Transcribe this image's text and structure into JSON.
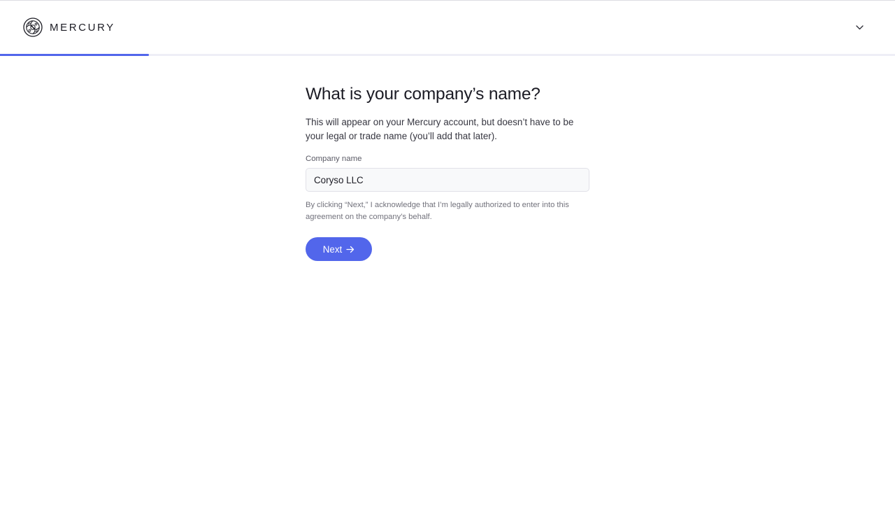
{
  "header": {
    "brand_name": "MERCURY",
    "logo_icon": "mercury-logo-icon",
    "menu_icon": "chevron-down-icon"
  },
  "progress": {
    "fraction": 0.1664,
    "color": "#5266eb",
    "track_color": "#eeeef6"
  },
  "form": {
    "title": "What is your company’s name?",
    "subtitle": "This will appear on your Mercury account, but doesn’t have to be your legal or trade name (you’ll add that later).",
    "company_name_label": "Company name",
    "company_name_value": "Coryso LLC",
    "disclaimer": "By clicking “Next,” I acknowledge that I’m legally authorized to enter into this agreement on the company’s behalf.",
    "next_label": "Next",
    "next_icon": "arrow-right-icon"
  },
  "colors": {
    "accent": "#5266eb",
    "text_primary": "#1b1b24",
    "text_muted": "#72727c"
  }
}
